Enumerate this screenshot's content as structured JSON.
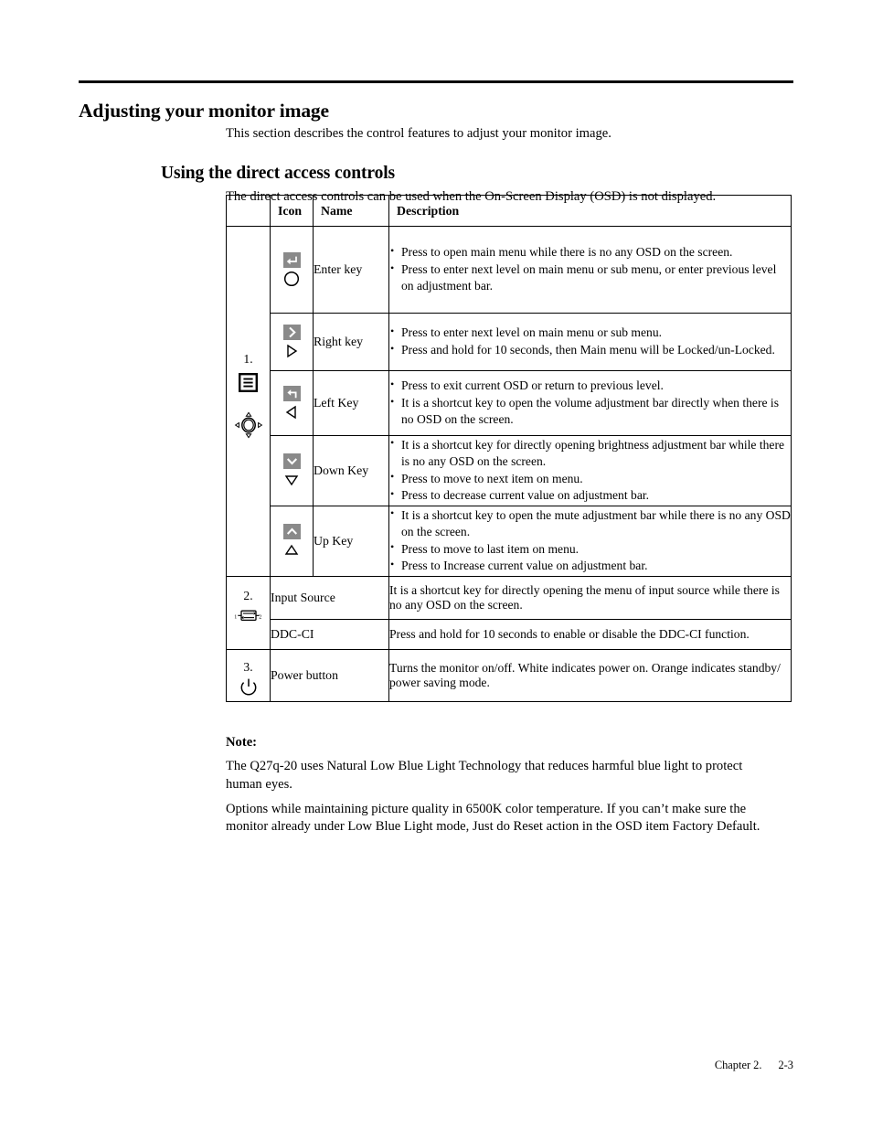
{
  "headings": {
    "h1": "Adjusting your monitor image",
    "h1_intro": "This section describes the control features to adjust your monitor image.",
    "h2": "Using the direct access controls",
    "h2_intro": "The direct access controls can be used when the On-Screen Display (OSD) is not displayed."
  },
  "table": {
    "columns": [
      "",
      "Icon",
      "Name",
      "Description"
    ],
    "groups": [
      {
        "number": "1.",
        "icons": [
          "menu-box-icon",
          "joystick-icon"
        ],
        "rows": [
          {
            "icon_keys": [
              "enter-key-gray",
              "circle-outline"
            ],
            "name": "Enter key",
            "description": [
              "Press to open main menu while there is no any OSD on the screen.",
              "Press to enter next level on main menu or sub menu, or enter previous level on adjustment bar."
            ]
          },
          {
            "icon_keys": [
              "right-chevron-gray",
              "triangle-right-outline"
            ],
            "name": "Right key",
            "description": [
              "Press to enter next level on main menu or sub menu.",
              "Press and hold for 10 seconds, then Main menu will be Locked/un-Locked."
            ]
          },
          {
            "icon_keys": [
              "back-arrow-gray",
              "triangle-left-outline"
            ],
            "name": "Left Key",
            "description": [
              "Press to exit current OSD or return to previous level.",
              "It is a shortcut key to open the volume adjustment bar directly when there is no OSD on the screen."
            ]
          },
          {
            "icon_keys": [
              "down-chevron-gray",
              "triangle-down-outline"
            ],
            "name": "Down Key",
            "description": [
              "It is a shortcut key for directly opening brightness adjustment bar while there is no any OSD on the screen.",
              "Press to move to next item on menu.",
              "Press to decrease current value on adjustment bar."
            ]
          },
          {
            "icon_keys": [
              "up-chevron-gray",
              "triangle-up-outline"
            ],
            "name": "Up Key",
            "description": [
              "It is a shortcut key to open the mute adjustment bar while there is no any OSD on the screen.",
              "Press to move to last item on menu.",
              "Press to Increase current value on adjustment bar."
            ]
          }
        ]
      },
      {
        "number": "2.",
        "icons": [
          "input-source-icon"
        ],
        "rows": [
          {
            "name": "Input Source",
            "description_plain": "It is a shortcut key for directly opening the menu of input source while there is no any OSD on the screen."
          },
          {
            "name": "DDC-CI",
            "description_plain": "Press and hold for 10 seconds to enable or disable the DDC-CI function."
          }
        ]
      },
      {
        "number": "3.",
        "icons": [
          "power-icon"
        ],
        "rows": [
          {
            "name": "Power button",
            "description_plain": "Turns the monitor on/off. White indicates power on. Orange indicates standby/ power saving mode."
          }
        ]
      }
    ]
  },
  "note": {
    "title": "Note:",
    "paragraphs": [
      "The Q27q-20 uses Natural Low Blue Light Technology that reduces harmful blue light to protect human eyes.",
      "Options while maintaining picture quality in 6500K color temperature. If you can’t make sure the monitor already under Low Blue Light mode, Just do Reset action in the OSD item Factory Default."
    ]
  },
  "footer": {
    "chapter": "Chapter 2.",
    "page": "2-3"
  },
  "colors": {
    "text": "#000000",
    "page_background": "#ffffff",
    "icon_gray": "#8a8a8a",
    "rule": "#000000"
  }
}
